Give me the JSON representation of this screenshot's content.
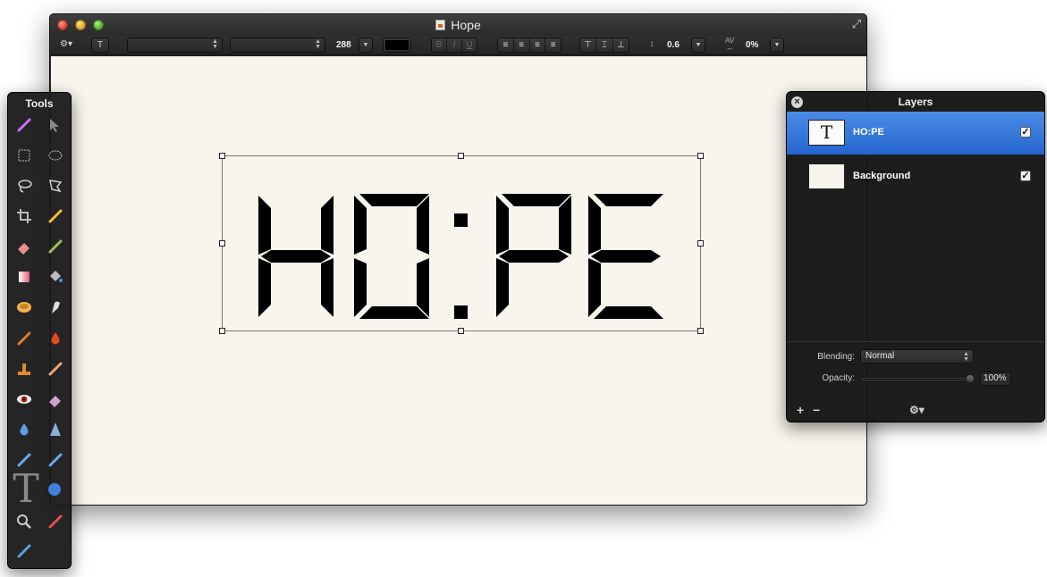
{
  "window": {
    "title": "Hope"
  },
  "toolbar": {
    "text_tool_label": "T",
    "font_size": "288",
    "bold_label": "B",
    "italic_label": "I",
    "underline_label": "U",
    "line_spacing": "0.6",
    "tracking_label": "AV",
    "tracking": "0%",
    "text_color": "#000000"
  },
  "canvas": {
    "background_color": "#f8f5ec",
    "text_layer_content": "HO:PE"
  },
  "tools_panel": {
    "title": "Tools",
    "tool_icons": [
      "magic-wand-icon",
      "move-icon",
      "rect-select-icon",
      "ellipse-select-icon",
      "lasso-icon",
      "polygon-lasso-icon",
      "crop-icon",
      "pencil-icon",
      "eraser-icon",
      "brush-icon",
      "gradient-icon",
      "paint-bucket-icon",
      "sponge-icon",
      "smudge-icon",
      "burn-icon",
      "dodge-icon",
      "clone-stamp-icon",
      "bandage-icon",
      "red-eye-icon",
      "eraser2-icon",
      "blur-icon",
      "sharpen-icon",
      "pen-icon",
      "freeform-pen-icon",
      "text-tool-icon",
      "shape-icon",
      "zoom-icon",
      "color-picker-icon",
      "color-swatch-icon"
    ],
    "text_tool_glyph": "T"
  },
  "layers_panel": {
    "title": "Layers",
    "layers": [
      {
        "name": "HO:PE",
        "thumb": "T",
        "visible": true,
        "selected": true
      },
      {
        "name": "Background",
        "thumb": "",
        "visible": true,
        "selected": false
      }
    ],
    "blending_label": "Blending:",
    "blending_value": "Normal",
    "opacity_label": "Opacity:",
    "opacity_value": "100%",
    "opacity_level": 1.0,
    "add_label": "+",
    "remove_label": "−",
    "check_glyph": "✓",
    "close_glyph": "×"
  },
  "colors": {
    "selection_highlight": "#2e6fd6",
    "canvas_bg": "#f8f5ec",
    "panel_bg": "#1c1c1c"
  }
}
